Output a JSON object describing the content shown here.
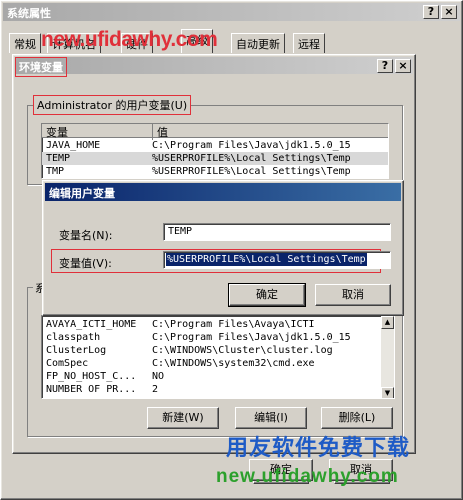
{
  "sysprops": {
    "title": "系统属性",
    "help": "?",
    "close": "×",
    "tabs": [
      "常规",
      "计算机名",
      "硬件",
      "高级",
      "自动更新",
      "远程"
    ],
    "ok": "确定",
    "cancel": "取消"
  },
  "watermark": {
    "top_url": "new.ufidawhy.com",
    "bottom_title": "用友软件免费下载",
    "bottom_url": "new.ufidawhy.com"
  },
  "envvars": {
    "title": "环境变量",
    "help": "?",
    "close": "×",
    "user_group": "Administrator 的用户变量(U)",
    "col_var": "变量",
    "col_val": "值",
    "user_vars": [
      {
        "name": "JAVA_HOME",
        "value": "C:\\Program Files\\Java\\jdk1.5.0_15"
      },
      {
        "name": "TEMP",
        "value": "%USERPROFILE%\\Local Settings\\Temp"
      },
      {
        "name": "TMP",
        "value": "%USERPROFILE%\\Local Settings\\Temp"
      }
    ],
    "sys_group_fragment": "系",
    "sys_vars": [
      {
        "name": "AVAYA_ICTI_HOME",
        "value": "C:\\Program Files\\Avaya\\ICTI"
      },
      {
        "name": "classpath",
        "value": "C:\\Program Files\\Java\\jdk1.5.0_15"
      },
      {
        "name": "ClusterLog",
        "value": "C:\\WINDOWS\\Cluster\\cluster.log"
      },
      {
        "name": "ComSpec",
        "value": "C:\\WINDOWS\\system32\\cmd.exe"
      },
      {
        "name": "FP_NO_HOST_C...",
        "value": "NO"
      },
      {
        "name": "NUMBER OF PR...",
        "value": "2"
      }
    ],
    "new_btn": "新建(W)",
    "edit_btn": "编辑(I)",
    "delete_btn": "删除(L)",
    "ok": "确定",
    "cancel": "取消"
  },
  "edit_dialog": {
    "title": "编辑用户变量",
    "name_label": "变量名(N):",
    "name_value": "TEMP",
    "value_label": "变量值(V):",
    "value_value": "%USERPROFILE%\\Local Settings\\Temp",
    "ok": "确定",
    "cancel": "取消"
  },
  "colors": {
    "dialog_face": "#d4d0c8",
    "titlebar_blue": "#0a246a",
    "highlight": "#0a246a",
    "red_annotation": "#e0303a",
    "watermark_blue": "#1e5bc6",
    "watermark_green": "#2ca02c"
  }
}
